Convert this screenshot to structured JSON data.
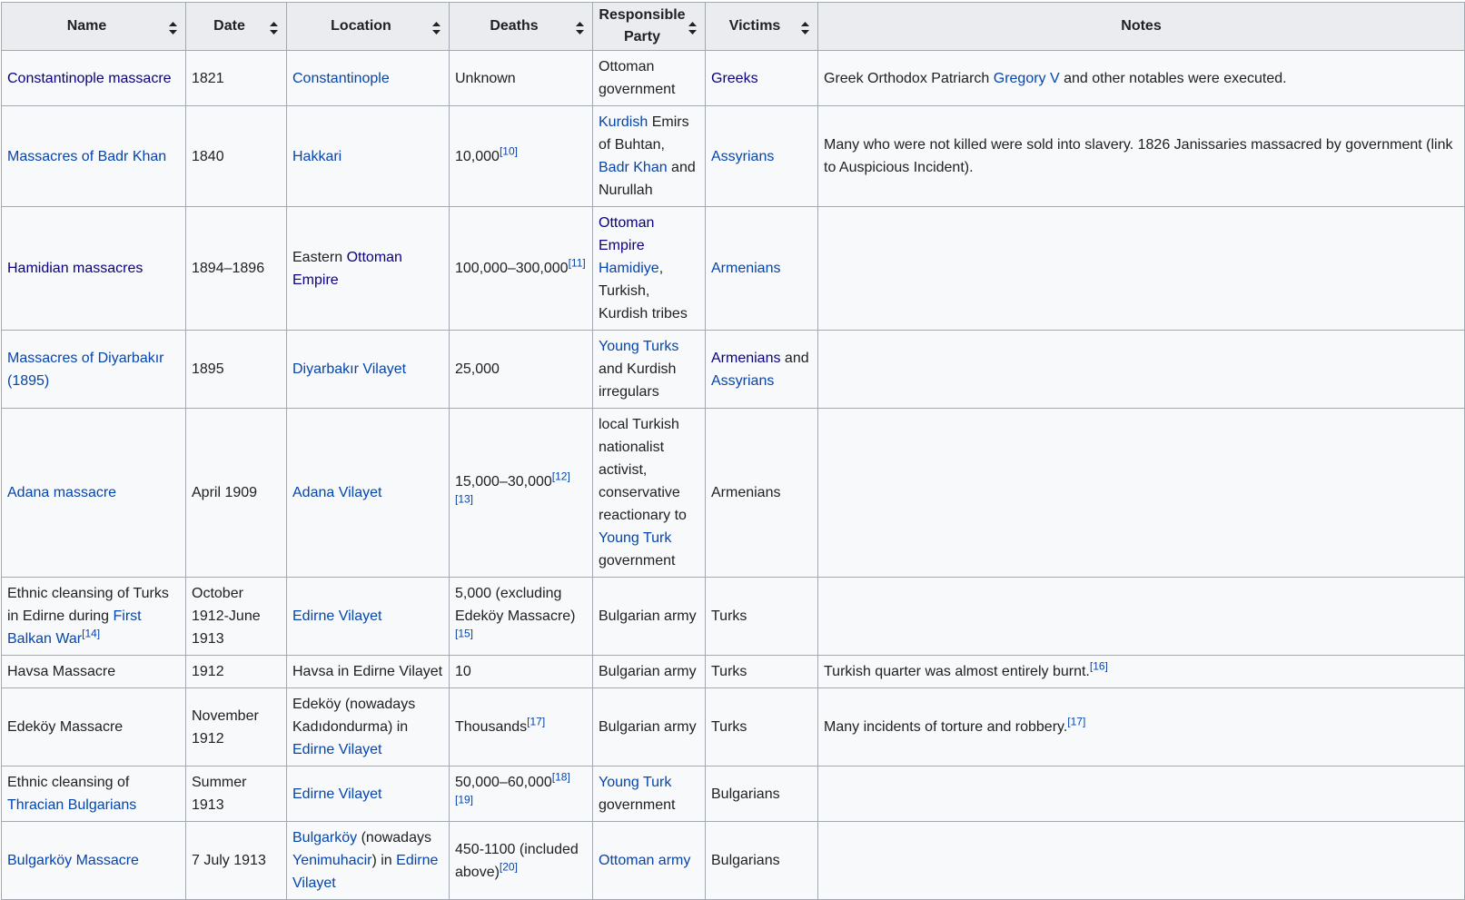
{
  "table": {
    "headers": [
      {
        "label": "Name",
        "sortable": true
      },
      {
        "label": "Date",
        "sortable": true
      },
      {
        "label": "Location",
        "sortable": true
      },
      {
        "label": "Deaths",
        "sortable": true
      },
      {
        "label": "Responsible Party",
        "sortable": true
      },
      {
        "label": "Victims",
        "sortable": true
      },
      {
        "label": "Notes",
        "sortable": false
      }
    ],
    "sort_icon": "sort-updown-icon",
    "link_colors": {
      "unvisited": "#0645ad",
      "visited": "#0b0080"
    },
    "rows": [
      {
        "name": [
          {
            "text": "Constantinople massacre",
            "link": "visited"
          }
        ],
        "date": "1821",
        "location": [
          {
            "text": "Constantinople",
            "link": "unvisited"
          }
        ],
        "deaths": [
          {
            "text": "Unknown"
          }
        ],
        "responsible": [
          {
            "text": "Ottoman government"
          }
        ],
        "victims": [
          {
            "text": "Greeks",
            "link": "visited"
          }
        ],
        "notes": [
          {
            "text": "Greek Orthodox Patriarch "
          },
          {
            "text": "Gregory V",
            "link": "unvisited"
          },
          {
            "text": " and other notables were executed."
          }
        ]
      },
      {
        "name": [
          {
            "text": "Massacres of Badr Khan",
            "link": "unvisited"
          }
        ],
        "date": "1840",
        "location": [
          {
            "text": "Hakkari",
            "link": "unvisited"
          }
        ],
        "deaths": [
          {
            "text": "10,000"
          },
          {
            "ref": "[10]"
          }
        ],
        "responsible": [
          {
            "text": "Kurdish",
            "link": "unvisited"
          },
          {
            "text": " Emirs of Buhtan, "
          },
          {
            "text": "Badr Khan",
            "link": "unvisited"
          },
          {
            "text": " and Nurullah"
          }
        ],
        "victims": [
          {
            "text": "Assyrians",
            "link": "unvisited"
          }
        ],
        "notes": [
          {
            "text": "Many who were not killed were sold into slavery. 1826 Janissaries massacred by government (link to Auspicious Incident)."
          }
        ]
      },
      {
        "name": [
          {
            "text": "Hamidian massacres",
            "link": "visited"
          }
        ],
        "date": "1894–1896",
        "location": [
          {
            "text": "Eastern "
          },
          {
            "text": "Ottoman Empire",
            "link": "visited"
          }
        ],
        "deaths": [
          {
            "text": "100,000–300,000"
          },
          {
            "ref": "[11]"
          }
        ],
        "responsible": [
          {
            "text": "Ottoman Empire",
            "link": "visited"
          },
          {
            "text": " "
          },
          {
            "text": "Hamidiye",
            "link": "unvisited"
          },
          {
            "text": ", Turkish, Kurdish tribes"
          }
        ],
        "victims": [
          {
            "text": "Armenians",
            "link": "unvisited"
          }
        ],
        "notes": []
      },
      {
        "name": [
          {
            "text": "Massacres of Diyarbakır (1895)",
            "link": "unvisited"
          }
        ],
        "date": "1895",
        "location": [
          {
            "text": "Diyarbakır Vilayet",
            "link": "unvisited"
          }
        ],
        "deaths": [
          {
            "text": "25,000"
          }
        ],
        "responsible": [
          {
            "text": "Young Turks",
            "link": "unvisited"
          },
          {
            "text": " and Kurdish irregulars"
          }
        ],
        "victims": [
          {
            "text": "Armenians",
            "link": "visited"
          },
          {
            "text": " and "
          },
          {
            "text": "Assyrians",
            "link": "unvisited"
          }
        ],
        "notes": []
      },
      {
        "name": [
          {
            "text": "Adana massacre",
            "link": "unvisited"
          }
        ],
        "date": "April 1909",
        "location": [
          {
            "text": "Adana Vilayet",
            "link": "unvisited"
          }
        ],
        "deaths": [
          {
            "text": "15,000–30,000"
          },
          {
            "ref": "[12]"
          },
          {
            "ref": "[13]"
          }
        ],
        "responsible": [
          {
            "text": "local Turkish nationalist activist, conservative reactionary to "
          },
          {
            "text": "Young Turk",
            "link": "unvisited"
          },
          {
            "text": " government"
          }
        ],
        "victims": [
          {
            "text": "Armenians"
          }
        ],
        "notes": []
      },
      {
        "name": [
          {
            "text": "Ethnic cleansing of Turks in Edirne during "
          },
          {
            "text": "First Balkan War",
            "link": "unvisited"
          },
          {
            "ref": "[14]"
          }
        ],
        "date": "October 1912-June 1913",
        "location": [
          {
            "text": "Edirne Vilayet",
            "link": "unvisited"
          }
        ],
        "deaths": [
          {
            "text": "5,000 (excluding Edeköy Massacre)"
          },
          {
            "ref": "[15]"
          }
        ],
        "responsible": [
          {
            "text": "Bulgarian army"
          }
        ],
        "victims": [
          {
            "text": "Turks"
          }
        ],
        "notes": []
      },
      {
        "name": [
          {
            "text": "Havsa Massacre"
          }
        ],
        "date": "1912",
        "location": [
          {
            "text": "Havsa in Edirne Vilayet"
          }
        ],
        "deaths": [
          {
            "text": "10"
          }
        ],
        "responsible": [
          {
            "text": "Bulgarian army"
          }
        ],
        "victims": [
          {
            "text": "Turks"
          }
        ],
        "notes": [
          {
            "text": "Turkish quarter was almost entirely burnt."
          },
          {
            "ref": "[16]"
          }
        ]
      },
      {
        "name": [
          {
            "text": "Edeköy Massacre"
          }
        ],
        "date": "November 1912",
        "location": [
          {
            "text": "Edeköy (nowadays Kadıdondurma) in "
          },
          {
            "text": "Edirne Vilayet",
            "link": "unvisited"
          }
        ],
        "deaths": [
          {
            "text": "Thousands"
          },
          {
            "ref": "[17]"
          }
        ],
        "responsible": [
          {
            "text": "Bulgarian army"
          }
        ],
        "victims": [
          {
            "text": "Turks"
          }
        ],
        "notes": [
          {
            "text": "Many incidents of torture and robbery."
          },
          {
            "ref": "[17]"
          }
        ]
      },
      {
        "name": [
          {
            "text": "Ethnic cleansing of "
          },
          {
            "text": "Thracian Bulgarians",
            "link": "unvisited"
          }
        ],
        "date": "Summer 1913",
        "location": [
          {
            "text": "Edirne Vilayet",
            "link": "unvisited"
          }
        ],
        "deaths": [
          {
            "text": "50,000–60,000"
          },
          {
            "ref": "[18]"
          },
          {
            "ref": "[19]"
          }
        ],
        "responsible": [
          {
            "text": "Young Turk",
            "link": "unvisited"
          },
          {
            "text": " government"
          }
        ],
        "victims": [
          {
            "text": "Bulgarians"
          }
        ],
        "notes": []
      },
      {
        "name": [
          {
            "text": "Bulgarköy Massacre",
            "link": "unvisited"
          }
        ],
        "date": "7 July 1913",
        "location": [
          {
            "text": "Bulgarköy",
            "link": "unvisited"
          },
          {
            "text": " (nowadays "
          },
          {
            "text": "Yenimuhacir",
            "link": "unvisited"
          },
          {
            "text": ") in "
          },
          {
            "text": "Edirne Vilayet",
            "link": "unvisited"
          }
        ],
        "deaths": [
          {
            "text": "450-1100 (included above)"
          },
          {
            "ref": "[20]"
          }
        ],
        "responsible": [
          {
            "text": "Ottoman army",
            "link": "unvisited"
          }
        ],
        "victims": [
          {
            "text": "Bulgarians"
          }
        ],
        "notes": []
      }
    ]
  }
}
